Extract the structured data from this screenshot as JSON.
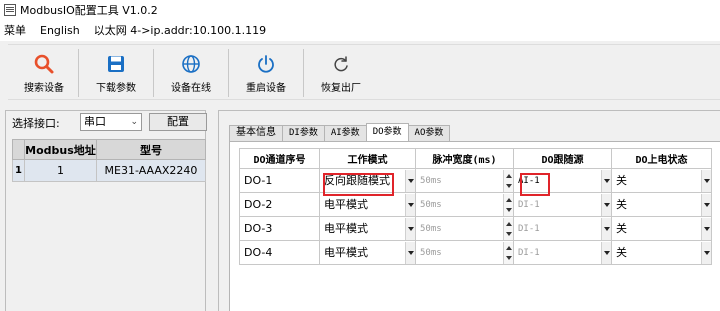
{
  "window": {
    "title": "ModbusIO配置工具 V1.0.2",
    "icon": "app-window-icon"
  },
  "menu": {
    "items": [
      "菜单",
      "English",
      "以太网 4->ip.addr:10.100.1.119"
    ]
  },
  "toolbar": {
    "buttons": [
      {
        "label": "搜索设备",
        "icon": "search-icon",
        "color": "#e8502b"
      },
      {
        "label": "下载参数",
        "icon": "save-icon",
        "color": "#1a6fc4"
      },
      {
        "label": "设备在线",
        "icon": "globe-icon",
        "color": "#1a6fc4"
      },
      {
        "label": "重启设备",
        "icon": "power-icon",
        "color": "#1a6fc4"
      },
      {
        "label": "恢复出厂",
        "icon": "refresh-icon",
        "color": "#444444"
      }
    ]
  },
  "port": {
    "label": "选择接口:",
    "value": "串口",
    "config_label": "配置"
  },
  "device_table": {
    "headers": [
      "Modbus地址",
      "型号"
    ],
    "rows": [
      {
        "index": "1",
        "address": "1",
        "model": "ME31-AAAX2240"
      }
    ]
  },
  "tabs": [
    {
      "label": "基本信息",
      "active": false
    },
    {
      "label": "DI参数",
      "active": false
    },
    {
      "label": "AI参数",
      "active": false
    },
    {
      "label": "DO参数",
      "active": true
    },
    {
      "label": "AO参数",
      "active": false
    }
  ],
  "do_table": {
    "headers": [
      "DO通道序号",
      "工作模式",
      "脉冲宽度(ms)",
      "DO跟随源",
      "DO上电状态"
    ],
    "rows": [
      {
        "channel": "DO-1",
        "mode": "反向跟随模式",
        "pulse": "50ms",
        "source": "AI-1",
        "power_on": "关"
      },
      {
        "channel": "DO-2",
        "mode": "电平模式",
        "pulse": "50ms",
        "source": "DI-1",
        "power_on": "关"
      },
      {
        "channel": "DO-3",
        "mode": "电平模式",
        "pulse": "50ms",
        "source": "DI-1",
        "power_on": "关"
      },
      {
        "channel": "DO-4",
        "mode": "电平模式",
        "pulse": "50ms",
        "source": "DI-1",
        "power_on": "关"
      }
    ]
  },
  "highlight_color": "#e0242a"
}
